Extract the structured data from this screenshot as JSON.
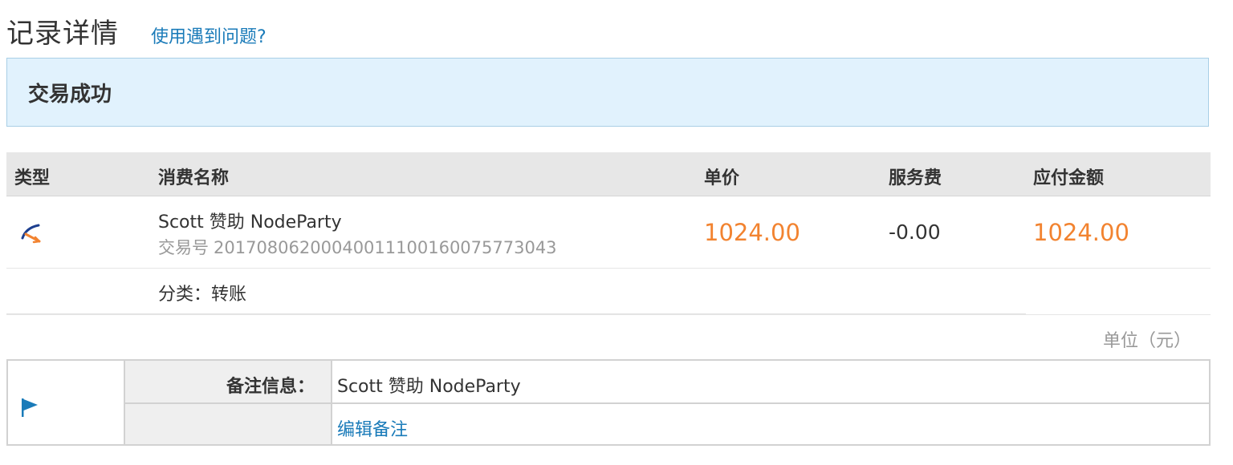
{
  "header": {
    "title": "记录详情",
    "help_link": "使用遇到问题?"
  },
  "status": {
    "text": "交易成功"
  },
  "table": {
    "columns": [
      "类型",
      "消费名称",
      "单价",
      "服务费",
      "应付金额"
    ],
    "row": {
      "type_icon": "transfer-arrow-icon",
      "name": "Scott 赞助 NodeParty",
      "trade_label": "交易号",
      "trade_no": "20170806200040011100160075773043",
      "unit_price": "1024.00",
      "service_fee": "-0.00",
      "payable": "1024.00",
      "category": "分类：转账"
    },
    "unit_note": "单位（元）"
  },
  "memo": {
    "icon": "flag-icon",
    "label": "备注信息：",
    "value": "Scott 赞助 NodeParty",
    "edit_label": "编辑备注"
  },
  "colors": {
    "accent_link": "#1a7bb9",
    "amount": "#f28330",
    "status_bg": "#e1f2fd"
  }
}
